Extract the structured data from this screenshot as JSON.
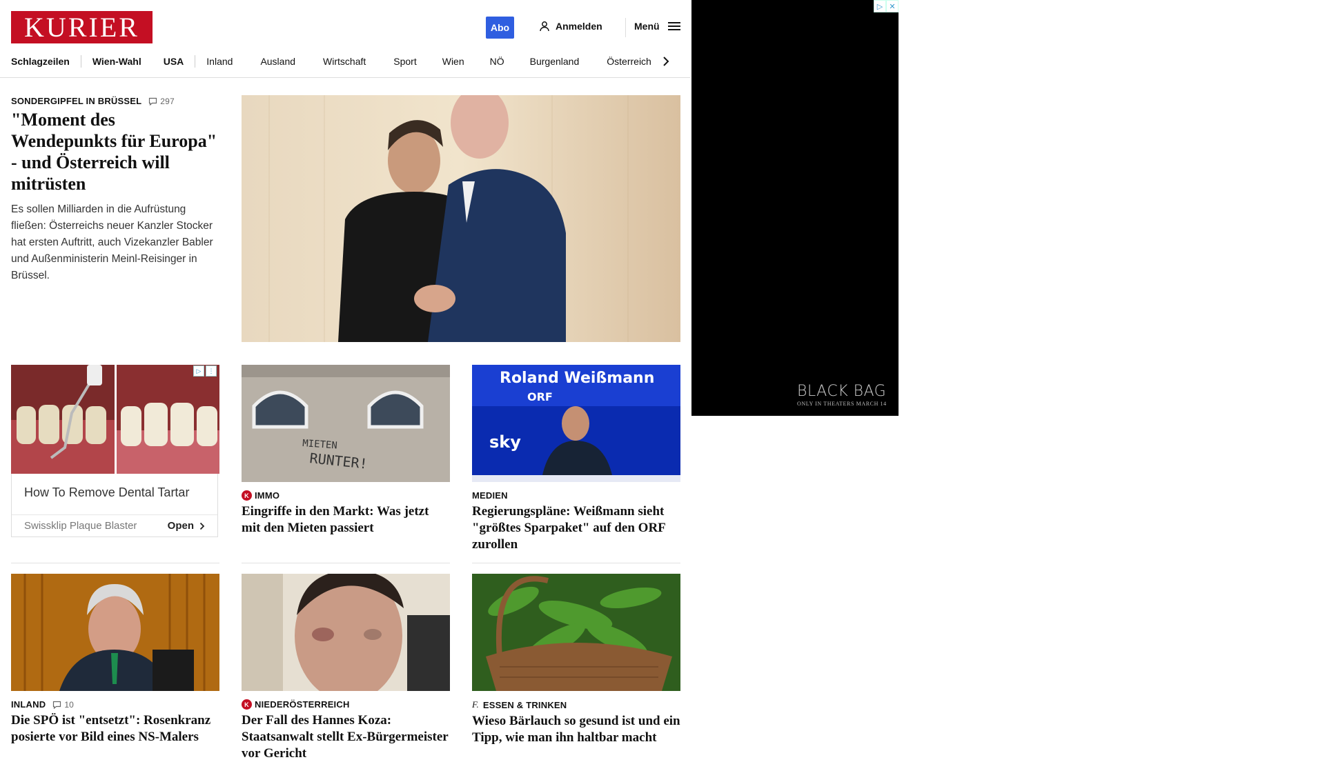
{
  "header": {
    "logo_text": "KURIER",
    "abo_label": "Abo",
    "login_label": "Anmelden",
    "menu_label": "Menü"
  },
  "nav": {
    "items": [
      "Schlagzeilen",
      "Wien-Wahl",
      "USA",
      "Inland",
      "Ausland",
      "Wirtschaft",
      "Sport",
      "Wien",
      "NÖ",
      "Burgenland",
      "Österreich"
    ]
  },
  "lead": {
    "kicker": "SONDERGIPFEL IN BRÜSSEL",
    "comments": "297",
    "title": "\"Moment des Wendepunkts für Europa\" - und Österreich will mitrüsten",
    "text": "Es sollen Milliarden in die Aufrüstung fließen: Österreichs neuer Kanzler Stocker hat ersten Auftritt, auch Vizekanzler Babler und Außenministerin Meinl-Reisinger in Brüssel."
  },
  "ad_card": {
    "title": "How To Remove Dental Tartar",
    "source": "Swissklip Plaque Blaster",
    "cta": "Open"
  },
  "cards": [
    {
      "kicker": "IMMO",
      "title": "Eingriffe in den Markt: Was jetzt mit den Mieten passiert",
      "wall_text_1": "MIETEN",
      "wall_text_2": "RUNTER!"
    },
    {
      "kicker": "MEDIEN",
      "title": "Regierungspläne: Weißmann sieht \"größtes Sparpaket\" auf den ORF zurollen",
      "screen_name": "Roland Weißmann",
      "screen_sub": "ORF"
    },
    {
      "kicker": "INLAND",
      "comments": "10",
      "title": "Die SPÖ ist \"entsetzt\": Rosenkranz posierte vor Bild eines NS-Malers"
    },
    {
      "kicker": "NIEDERÖSTERREICH",
      "title": "Der Fall des Hannes Koza: Staatsanwalt stellt Ex-Bürgermeister vor Gericht"
    },
    {
      "kicker": "ESSEN & TRINKEN",
      "title": "Wieso Bärlauch so gesund ist und ein Tipp, wie man ihn haltbar macht"
    }
  ],
  "side_ad": {
    "brand": "BLACK BAG",
    "tagline": "ONLY IN THEATERS MARCH 14"
  },
  "colors": {
    "brand_red": "#c40f23",
    "abo_blue": "#2f5ee0"
  }
}
